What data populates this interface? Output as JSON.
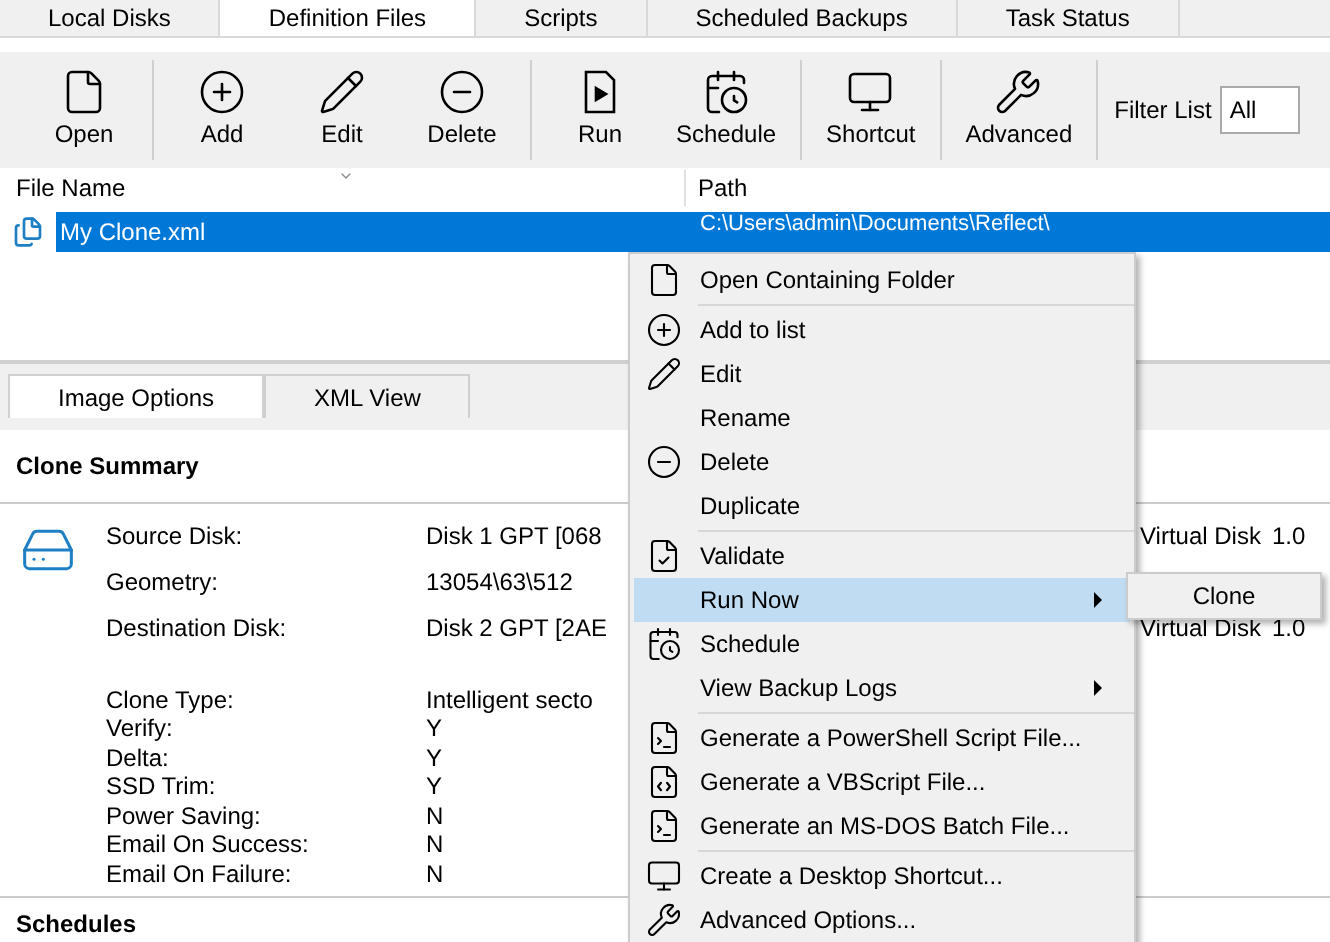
{
  "tabs": [
    {
      "label": "Local Disks",
      "selected": false
    },
    {
      "label": "Definition Files",
      "selected": true
    },
    {
      "label": "Scripts",
      "selected": false
    },
    {
      "label": "Scheduled Backups",
      "selected": false
    },
    {
      "label": "Task Status",
      "selected": false
    }
  ],
  "toolbar": {
    "groups": [
      [
        "Open"
      ],
      [
        "Add",
        "Edit",
        "Delete"
      ],
      [
        "Run",
        "Schedule"
      ],
      [
        "Shortcut"
      ],
      [
        "Advanced"
      ]
    ],
    "filter": {
      "label": "Filter List",
      "value": "All"
    }
  },
  "file_list": {
    "columns": [
      "File Name",
      "Path"
    ],
    "rows": [
      {
        "name": "My Clone.xml",
        "path": "C:\\Users\\admin\\Documents\\Reflect\\",
        "selected": true
      }
    ]
  },
  "detail_tabs": [
    {
      "label": "Image Options",
      "selected": true
    },
    {
      "label": "XML View",
      "selected": false
    }
  ],
  "clone_summary": {
    "title": "Clone Summary",
    "groups": [
      [
        {
          "label": "Source Disk:",
          "value": "Disk 1 GPT [068",
          "extra": "Virtual Disk",
          "extra_value": "1.0"
        },
        {
          "label": "Geometry:",
          "value": "13054\\63\\512"
        },
        {
          "label": "Destination Disk:",
          "value": "Disk 2 GPT [2AE",
          "extra": "Virtual Disk",
          "extra_value": "1.0"
        }
      ],
      [
        {
          "label": "Clone Type:",
          "value": "Intelligent secto"
        },
        {
          "label": "Verify:",
          "value": "Y"
        },
        {
          "label": "Delta:",
          "value": "Y"
        },
        {
          "label": "SSD Trim:",
          "value": "Y"
        },
        {
          "label": "Power Saving:",
          "value": "N"
        },
        {
          "label": "Email On Success:",
          "value": "N"
        },
        {
          "label": "Email On Failure:",
          "value": "N"
        }
      ]
    ]
  },
  "schedules": {
    "title": "Schedules"
  },
  "context_menu": {
    "groups": [
      [
        {
          "label": "Open Containing Folder",
          "selected": false,
          "submenu": false
        }
      ],
      [
        {
          "label": "Add to list",
          "selected": false,
          "submenu": false
        },
        {
          "label": "Edit",
          "selected": false,
          "submenu": false
        },
        {
          "label": "Rename",
          "selected": false,
          "submenu": false
        },
        {
          "label": "Delete",
          "selected": false,
          "submenu": false
        },
        {
          "label": "Duplicate",
          "selected": false,
          "submenu": false
        }
      ],
      [
        {
          "label": "Validate",
          "selected": false,
          "submenu": false
        },
        {
          "label": "Run Now",
          "selected": true,
          "submenu": true
        },
        {
          "label": "Schedule",
          "selected": false,
          "submenu": false
        },
        {
          "label": "View Backup Logs",
          "selected": false,
          "submenu": true
        }
      ],
      [
        {
          "label": "Generate a PowerShell Script File...",
          "selected": false,
          "submenu": false
        },
        {
          "label": "Generate a VBScript File...",
          "selected": false,
          "submenu": false
        },
        {
          "label": "Generate an MS-DOS Batch File...",
          "selected": false,
          "submenu": false
        }
      ],
      [
        {
          "label": "Create a Desktop Shortcut...",
          "selected": false,
          "submenu": false
        },
        {
          "label": "Advanced Options...",
          "selected": false,
          "submenu": false
        }
      ]
    ],
    "submenu": [
      "Clone"
    ]
  }
}
